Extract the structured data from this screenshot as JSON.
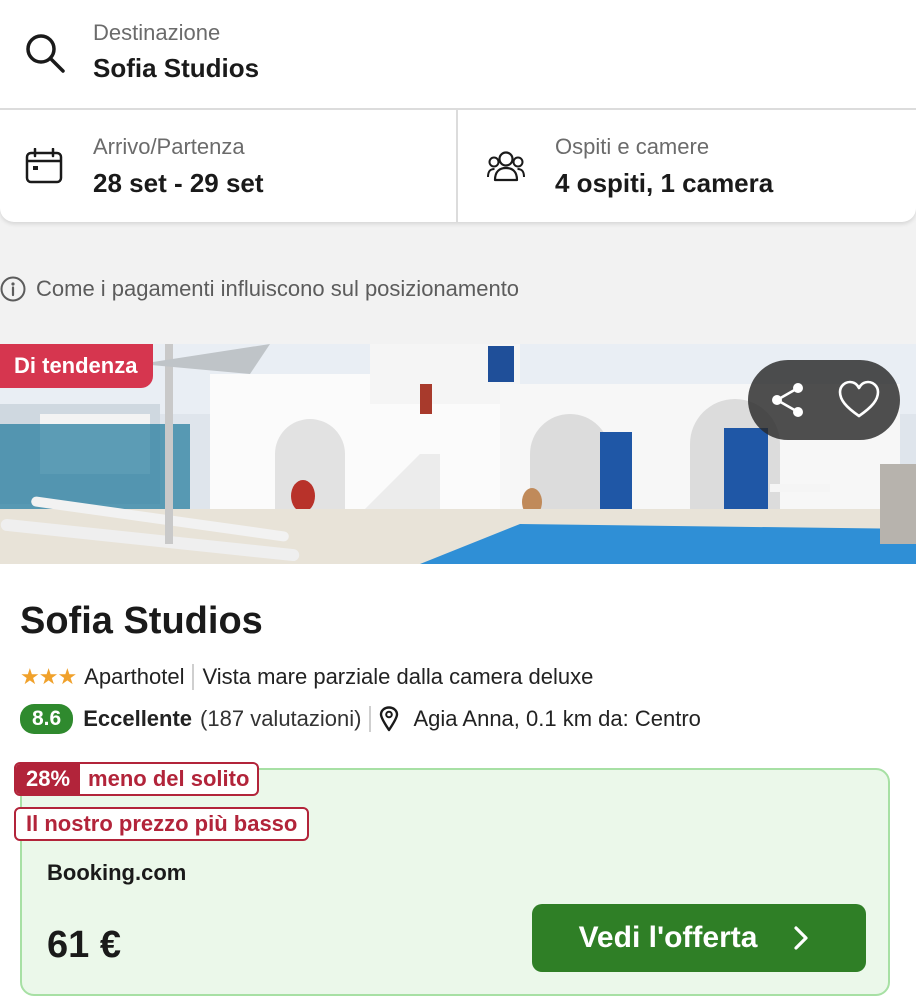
{
  "search": {
    "destination": {
      "label": "Destinazione",
      "value": "Sofia Studios",
      "icon": "search-icon"
    },
    "dates": {
      "label": "Arrivo/Partenza",
      "value": "28 set - 29 set",
      "icon": "calendar-icon"
    },
    "guests": {
      "label": "Ospiti e camere",
      "value": "4 ospiti, 1 camera",
      "icon": "guests-icon"
    }
  },
  "disclaimer": {
    "text": "Come i pagamenti influiscono sul posizionamento",
    "icon": "info-icon"
  },
  "result": {
    "badge": "Di tendenza",
    "badge_color": "#d6364f",
    "actions": {
      "share_icon": "share-icon",
      "favorite_icon": "heart-icon"
    },
    "name": "Sofia Studios",
    "stars": 3,
    "stars_glyph": "★★★",
    "type": "Aparthotel",
    "feature": "Vista mare parziale dalla camera deluxe",
    "rating_score": "8.6",
    "rating_label": "Eccellente",
    "rating_count": "(187 valutazioni)",
    "location": "Agia Anna, 0.1 km da: Centro",
    "location_icon": "map-pin-icon",
    "deal": {
      "percent": "28%",
      "percent_text": "meno del solito",
      "lowest_text": "Il nostro prezzo più basso",
      "provider": "Booking.com",
      "price": "61 €",
      "cta": "Vedi l'offerta",
      "accent_color": "#2f7f26",
      "tag_color": "#b2243a"
    }
  }
}
